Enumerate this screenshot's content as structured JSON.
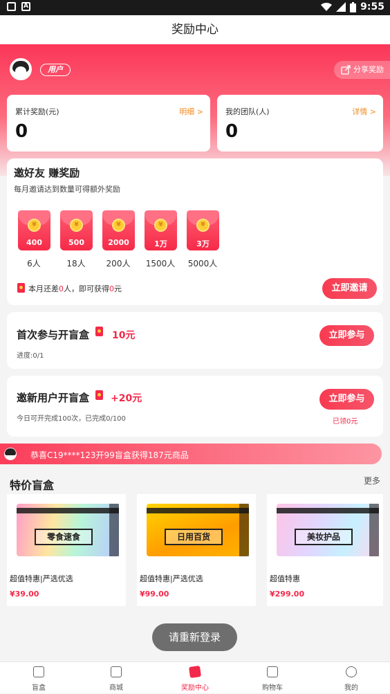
{
  "status": {
    "time": "9:55",
    "app_icon": "A"
  },
  "title": "奖励中心",
  "user": {
    "tag": "用户",
    "share_label": "分享奖励"
  },
  "stats": [
    {
      "label": "累计奖励(元)",
      "link": "明细 >",
      "value": "0"
    },
    {
      "label": "我的团队(人)",
      "link": "详情 >",
      "value": "0"
    }
  ],
  "invite": {
    "title": "邀好友 赚奖励",
    "subtitle": "每月邀请达到数量可得额外奖励",
    "coin_symbol": "¥",
    "tiers": [
      {
        "amount": "400",
        "people": "6人"
      },
      {
        "amount": "500",
        "people": "18人"
      },
      {
        "amount": "2000",
        "people": "200人"
      },
      {
        "amount": "1万",
        "people": "1500人"
      },
      {
        "amount": "3万",
        "people": "5000人"
      }
    ],
    "note_prefix": "本月还差",
    "note_count": "0",
    "note_mid": "人，即可获得",
    "note_amount": "0",
    "note_suffix": "元",
    "button": "立即邀请"
  },
  "tasks": [
    {
      "title": "首次参与开盲盒",
      "amount": "10元",
      "sub": "进度:0/1",
      "button": "立即参与"
    },
    {
      "title": "邀新用户开盲盒",
      "amount": "+20元",
      "sub": "今日可开完成100次，已完成0/100",
      "button": "立即参与",
      "claimed": "已领0元"
    }
  ],
  "banner": "恭喜C19****123开99盲盒获得187元商品",
  "section": {
    "title": "特价盲盒",
    "more": "更多"
  },
  "products": [
    {
      "label": "零食速食",
      "name": "超值特惠|严选优选",
      "price": "¥39.00"
    },
    {
      "label": "日用百货",
      "name": "超值特惠|严选优选",
      "price": "¥99.00"
    },
    {
      "label": "美妆护品",
      "name": "超值特惠",
      "price": "¥299.00"
    }
  ],
  "toast": "请重新登录",
  "tabs": [
    {
      "label": "盲盒",
      "icon": "box-icon"
    },
    {
      "label": "商城",
      "icon": "bag-icon"
    },
    {
      "label": "奖励中心",
      "icon": "redpacket-icon"
    },
    {
      "label": "购物车",
      "icon": "cart-icon"
    },
    {
      "label": "我的",
      "icon": "person-icon"
    }
  ]
}
